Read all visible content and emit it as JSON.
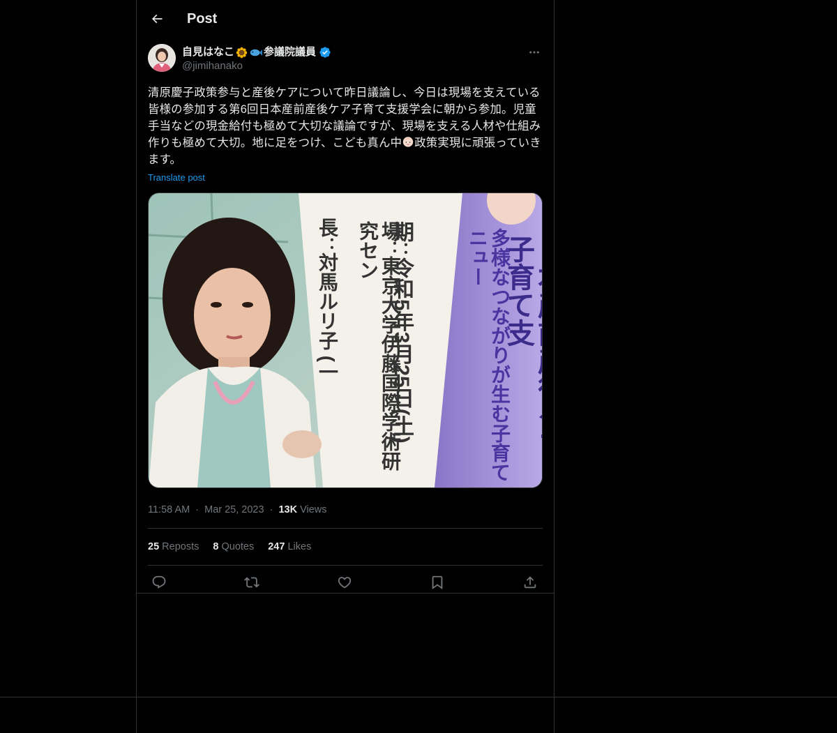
{
  "header": {
    "title": "Post",
    "back_icon": "arrow-left-icon"
  },
  "author": {
    "display_name": "自見はなこ",
    "name_suffix": "参議院議員",
    "emojis": [
      "sunflower-icon",
      "fish-icon"
    ],
    "verified": true,
    "handle": "@jimihanako"
  },
  "tweet": {
    "text_part1": "清原慶子政策参与と産後ケアについて昨日議論し、今日は現場を支えている皆様の参加する第6回日本産前産後ケア子育て支援学会に朝から参加。児童手当などの現金給付も極めて大切な議論ですが、現場を支える人材や仕組み作りも極めて大切。地に足をつけ、こども真ん中",
    "text_part2": "政策実現に頑張っていきます。",
    "translate_label": "Translate post"
  },
  "photo": {
    "sign_col1_heading": "期",
    "sign_col1_value": "令和5年3月25日(土)",
    "sign_col2_heading": "場",
    "sign_col2_value": "東京大学伊藤国際学術研究セン",
    "sign_col3_heading": "長",
    "sign_col3_value": "対馬ルリ子 (一",
    "banner_title": "日本産前産後ケア・子育て支",
    "banner_subtitle": "多様なつながりが生む子育てニュー"
  },
  "meta": {
    "time": "11:58 AM",
    "separator": "·",
    "date": "Mar 25, 2023",
    "views_count": "13K",
    "views_label": "Views"
  },
  "stats": {
    "reposts_count": "25",
    "reposts_label": "Reposts",
    "quotes_count": "8",
    "quotes_label": "Quotes",
    "likes_count": "247",
    "likes_label": "Likes"
  },
  "actions": [
    "reply-icon",
    "repost-icon",
    "like-icon",
    "bookmark-icon",
    "share-icon"
  ],
  "colors": {
    "background": "#000000",
    "text": "#e7e9ea",
    "secondary": "#71767b",
    "link": "#1d9bf0",
    "border": "#2f3336",
    "verified": "#1d9bf0"
  }
}
